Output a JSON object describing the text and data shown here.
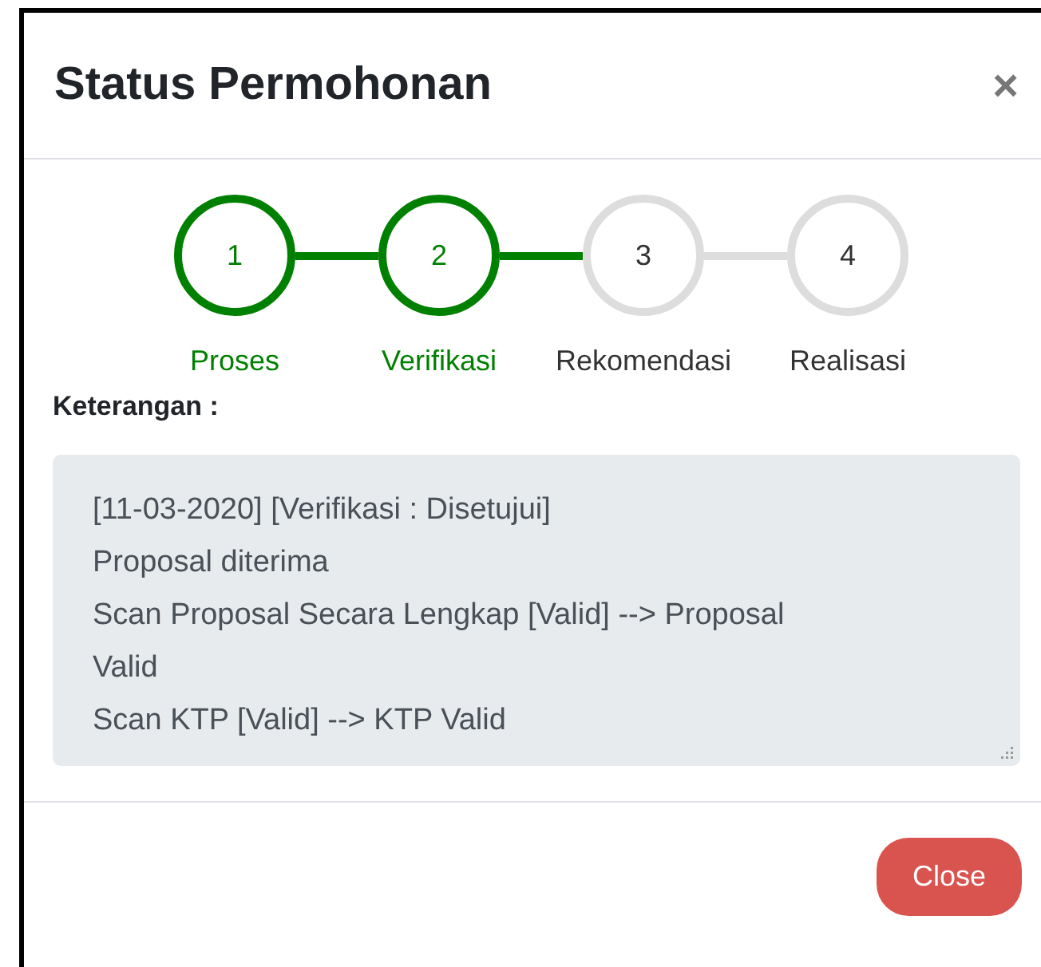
{
  "dialog": {
    "title": "Status Permohonan",
    "close_icon": "×"
  },
  "steps": [
    {
      "number": "1",
      "label": "Proses",
      "completed": true
    },
    {
      "number": "2",
      "label": "Verifikasi",
      "completed": true
    },
    {
      "number": "3",
      "label": "Rekomendasi",
      "completed": false
    },
    {
      "number": "4",
      "label": "Realisasi",
      "completed": false
    }
  ],
  "notes": {
    "label": "Keterangan :",
    "lines": [
      "[11-03-2020] [Verifikasi : Disetujui]",
      "Proposal diterima",
      "Scan Proposal Secara Lengkap [Valid] --> Proposal Valid",
      "Scan KTP [Valid] --> KTP Valid"
    ],
    "disabled": true
  },
  "footer": {
    "buttons": [
      "Close"
    ]
  }
}
